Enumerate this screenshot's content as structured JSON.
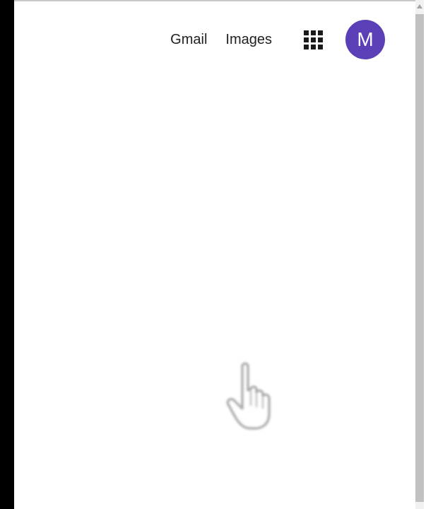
{
  "header": {
    "links": [
      {
        "label": "Gmail"
      },
      {
        "label": "Images"
      }
    ],
    "apps_icon": "apps-grid-icon",
    "avatar": {
      "initial": "M",
      "color": "#5a3fb6"
    }
  },
  "pointer": {
    "icon": "hand-pointer-cursor-icon"
  }
}
